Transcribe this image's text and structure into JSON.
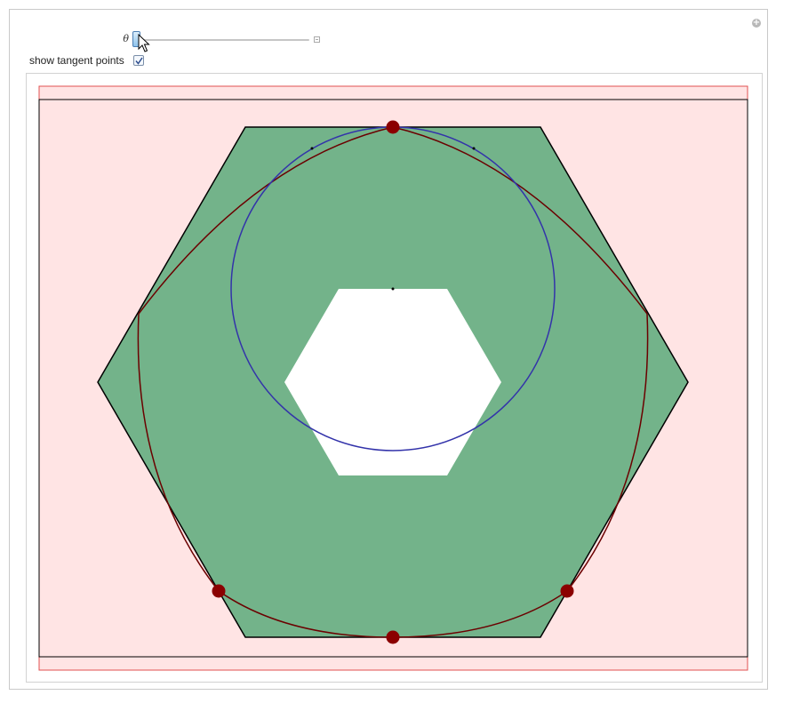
{
  "controls": {
    "theta": {
      "label": "θ",
      "value": 0.0
    },
    "show_tangent_points": {
      "label": "show tangent points",
      "checked": true
    }
  },
  "icons": {
    "panel_add": "plus-circle-icon",
    "slider_expand": "plus-square-icon",
    "cursor": "arrow-cursor-icon",
    "check": "check-icon"
  },
  "colors": {
    "page_background": "#ffe4e4",
    "page_border": "#e05050",
    "frame_border": "#000000",
    "hexagon_fill": "#73b38a",
    "hexagon_stroke": "#000000",
    "hole_fill": "#ffffff",
    "rolling_circle": "#3333aa",
    "locus_curve": "#6b0000",
    "tangent_point": "#8b0000",
    "slider_thumb": "#8ec3ec"
  }
}
